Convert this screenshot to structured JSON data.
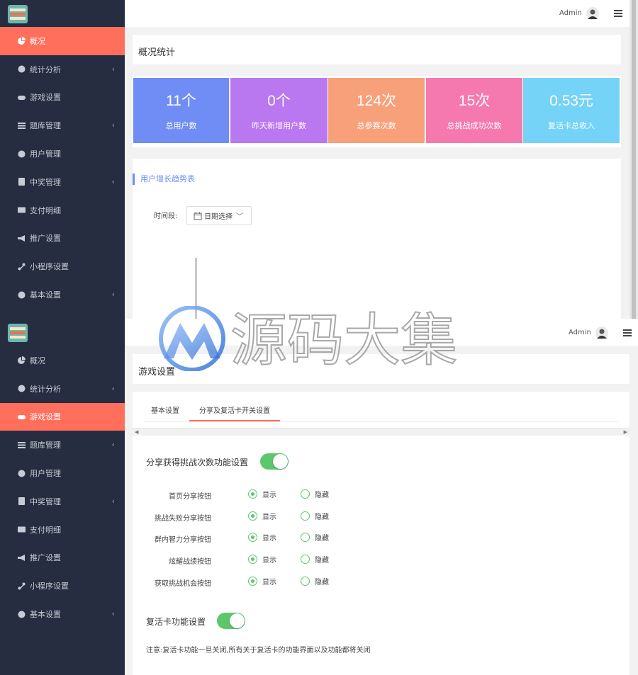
{
  "user": {
    "name": "Admin"
  },
  "sidebar": {
    "items": [
      {
        "label": "概况",
        "icon": "pie-chart-icon",
        "has_children": false
      },
      {
        "label": "统计分析",
        "icon": "globe-icon",
        "has_children": true
      },
      {
        "label": "游戏设置",
        "icon": "gamepad-icon",
        "has_children": false
      },
      {
        "label": "题库管理",
        "icon": "list-icon",
        "has_children": true
      },
      {
        "label": "用户管理",
        "icon": "user-icon",
        "has_children": false
      },
      {
        "label": "中奖管理",
        "icon": "trophy-icon",
        "has_children": true
      },
      {
        "label": "支付明细",
        "icon": "credit-card-icon",
        "has_children": false
      },
      {
        "label": "推广设置",
        "icon": "bullhorn-icon",
        "has_children": false
      },
      {
        "label": "小程序设置",
        "icon": "link-icon",
        "has_children": false
      },
      {
        "label": "基本设置",
        "icon": "gear-icon",
        "has_children": true
      }
    ],
    "chevron": "‹"
  },
  "overview": {
    "title": "概况统计",
    "stats": [
      {
        "value": "11个",
        "label": "总用户数",
        "color": "#6f8df4"
      },
      {
        "value": "0个",
        "label": "昨天新增用户数",
        "color": "#b977f0"
      },
      {
        "value": "124次",
        "label": "总参赛次数",
        "color": "#f8a07a"
      },
      {
        "value": "15次",
        "label": "总挑战成功次数",
        "color": "#f579ae"
      },
      {
        "value": "0.53元",
        "label": "复活卡总收入",
        "color": "#74d3f6"
      }
    ],
    "chart_title": "用户增长趋势表",
    "date_label": "时间段:",
    "date_picker": "日期选择"
  },
  "game_settings": {
    "title": "游戏设置",
    "tabs": [
      "基本设置",
      "分享及复活卡开关设置"
    ],
    "active_tab": 1,
    "share_section": {
      "title": "分享获得挑战次数功能设置",
      "enabled": true,
      "rows": [
        {
          "label": "首页分享按钮",
          "value": "显示"
        },
        {
          "label": "挑战失败分享按钮",
          "value": "显示"
        },
        {
          "label": "群内智力分享按钮",
          "value": "显示"
        },
        {
          "label": "炫耀战绩按钮",
          "value": "显示"
        },
        {
          "label": "获取挑战机会按钮",
          "value": "显示"
        }
      ],
      "option_show": "显示",
      "option_hide": "隐藏"
    },
    "revive_section": {
      "title": "复活卡功能设置",
      "enabled": true,
      "note": "注意:复活卡功能一旦关闭,所有关于复活卡的功能界面以及功能都将关闭"
    }
  },
  "watermark": {
    "text": "源码大集"
  },
  "colors": {
    "accent": "#ff6f5c",
    "sidebar": "#262d40",
    "toggle_on": "#5cc76b"
  }
}
